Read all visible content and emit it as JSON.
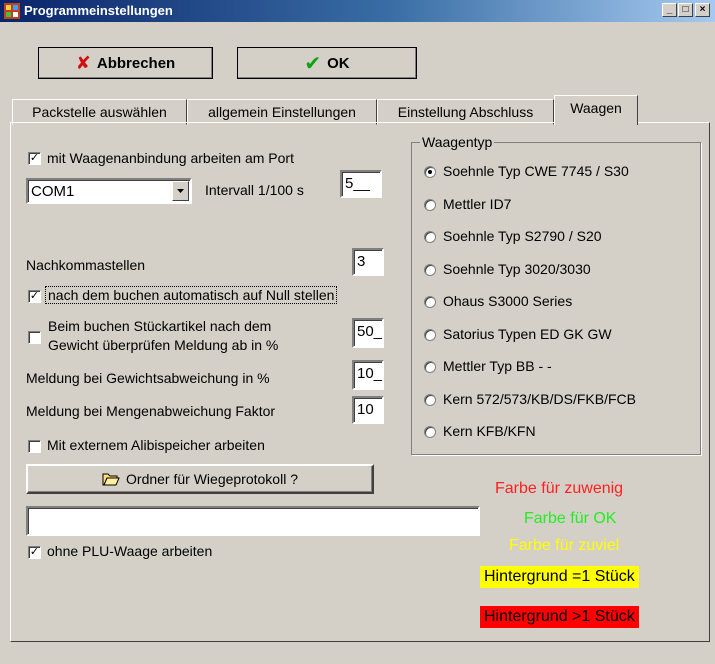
{
  "window": {
    "title": "Programmeinstellungen",
    "controls": [
      "_",
      "□",
      "×"
    ]
  },
  "toolbar": {
    "cancel_label": "Abbrechen",
    "ok_label": "OK"
  },
  "tabs": [
    {
      "label": "Packstelle auswählen",
      "active": false
    },
    {
      "label": "allgemein Einstellungen",
      "active": false
    },
    {
      "label": "Einstellung Abschluss",
      "active": false
    },
    {
      "label": "Waagen",
      "active": true
    }
  ],
  "left": {
    "scale_port_checkbox": {
      "label": "mit Waagenanbindung arbeiten am Port",
      "checked": true
    },
    "port_select": {
      "value": "COM1"
    },
    "interval_label": "Intervall 1/100 s",
    "interval_value": "5__",
    "decimals_label": "Nachkommastellen",
    "decimals_value": "3",
    "auto_zero_checkbox": {
      "label": "nach dem buchen automatisch auf Null stellen",
      "checked": true
    },
    "weight_check": {
      "line1": "Beim buchen Stückartikel nach dem",
      "line2": "Gewicht überprüfen     Meldung ab in %",
      "checked": false,
      "value": "50_"
    },
    "weight_deviation": {
      "label": "Meldung bei Gewichtsabweichung in %",
      "value": "10_"
    },
    "quantity_deviation": {
      "label": "Meldung bei Mengenabweichung Faktor",
      "value": "10"
    },
    "alibi_checkbox": {
      "label": "Mit externem Alibispeicher arbeiten",
      "checked": false
    },
    "folder_button_label": "Ordner für Wiegeprotokoll ?",
    "folder_path": "",
    "no_plu_checkbox": {
      "label": "ohne PLU-Waage arbeiten",
      "checked": true
    }
  },
  "scale_types": {
    "title": "Waagentyp",
    "options": [
      {
        "label": "Soehnle Typ CWE 7745 / S30",
        "selected": true
      },
      {
        "label": "Mettler ID7",
        "selected": false
      },
      {
        "label": "Soehnle Typ  S2790 / S20",
        "selected": false
      },
      {
        "label": "Soehnle Typ 3020/3030",
        "selected": false
      },
      {
        "label": "Ohaus S3000 Series",
        "selected": false
      },
      {
        "label": "Satorius Typen  ED GK GW",
        "selected": false
      },
      {
        "label": "Mettler Typ BB - -",
        "selected": false
      },
      {
        "label": "Kern 572/573/KB/DS/FKB/FCB",
        "selected": false
      },
      {
        "label": "Kern KFB/KFN",
        "selected": false
      }
    ]
  },
  "colors": {
    "too_little": {
      "label": "Farbe für zuwenig",
      "color": "#ff2020"
    },
    "ok": {
      "label": "Farbe für OK",
      "color": "#22ee22"
    },
    "too_much": {
      "label": "Farbe für zuviel",
      "color": "#ffff00"
    },
    "bg_one": {
      "label": "Hintergrund =1 Stück",
      "bg": "#ffff00",
      "color": "#000000"
    },
    "bg_many": {
      "label": "Hintergrund >1 Stück",
      "bg": "#ff0000",
      "color": "#000000"
    }
  }
}
